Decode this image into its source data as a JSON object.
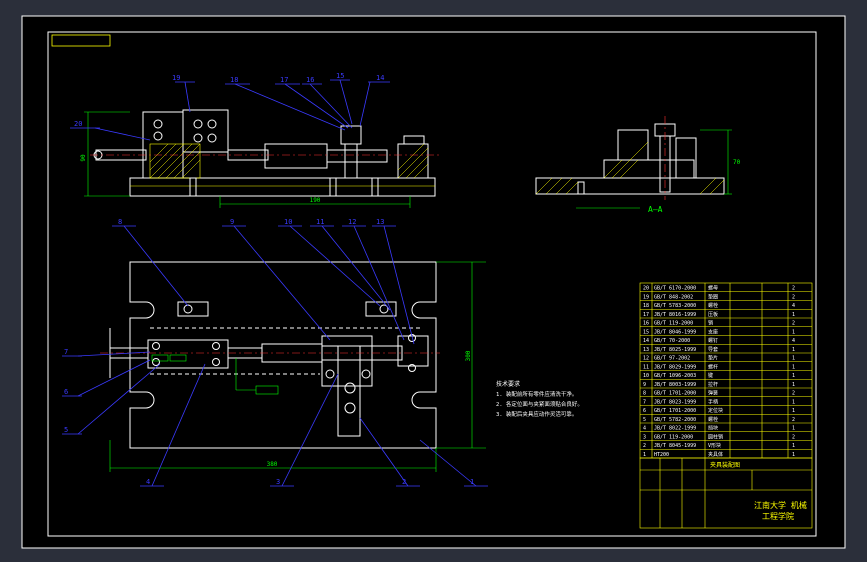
{
  "colors": {
    "frame_bg": "#2b2f3a",
    "sheet_bg": "#000000",
    "border": "#ffffff",
    "leader": "#3a3aff",
    "dimension": "#00ff00",
    "part_outline": "#ffffff",
    "hatch": "#ffff00",
    "center_line": "#ff3030",
    "title_block": "#ffff00"
  },
  "section_label": "A—A",
  "top_callouts": [
    "19",
    "18",
    "17",
    "16",
    "15",
    "14",
    "20"
  ],
  "plan_callouts_top": [
    "8",
    "9",
    "10",
    "11",
    "12",
    "13"
  ],
  "plan_callouts_left": [
    "7",
    "6",
    "5"
  ],
  "plan_callouts_bottom": [
    "4",
    "3",
    "2",
    "1"
  ],
  "dimensions": {
    "overall_length": "380",
    "plan_height": "300",
    "elev_length": "190",
    "elev_height": "90",
    "section_height": "70"
  },
  "technical_requirements": {
    "title": "技术要求",
    "lines": [
      "1. 装配前所有零件应清洗干净。",
      "2. 各定位面与夹紧面须贴合良好。",
      "3. 装配后夹具应动作灵活可靠。"
    ]
  },
  "bom_rows": [
    {
      "no": "20",
      "code": "GB/T 6170-2000",
      "name": "螺母",
      "qty": "2"
    },
    {
      "no": "19",
      "code": "GB/T 848-2002",
      "name": "垫圈",
      "qty": "2"
    },
    {
      "no": "18",
      "code": "GB/T 5783-2000",
      "name": "螺栓",
      "qty": "4"
    },
    {
      "no": "17",
      "code": "JB/T 8016-1999",
      "name": "压板",
      "qty": "1"
    },
    {
      "no": "16",
      "code": "GB/T 119-2000",
      "name": "销",
      "qty": "2"
    },
    {
      "no": "15",
      "code": "JB/T 8046-1999",
      "name": "支座",
      "qty": "1"
    },
    {
      "no": "14",
      "code": "GB/T 70-2000",
      "name": "螺钉",
      "qty": "4"
    },
    {
      "no": "13",
      "code": "JB/T 8025-1999",
      "name": "导套",
      "qty": "1"
    },
    {
      "no": "12",
      "code": "GB/T 97-2002",
      "name": "垫片",
      "qty": "1"
    },
    {
      "no": "11",
      "code": "JB/T 8029-1999",
      "name": "螺杆",
      "qty": "1"
    },
    {
      "no": "10",
      "code": "GB/T 1096-2003",
      "name": "键",
      "qty": "1"
    },
    {
      "no": "9",
      "code": "JB/T 8003-1999",
      "name": "拉杆",
      "qty": "1"
    },
    {
      "no": "8",
      "code": "GB/T 1701-2000",
      "name": "弹簧",
      "qty": "2"
    },
    {
      "no": "7",
      "code": "JB/T 8023-1999",
      "name": "手柄",
      "qty": "1"
    },
    {
      "no": "6",
      "code": "GB/T 1701-2000",
      "name": "定位块",
      "qty": "1"
    },
    {
      "no": "5",
      "code": "GB/T 5782-2000",
      "name": "螺栓",
      "qty": "2"
    },
    {
      "no": "4",
      "code": "JB/T 8022-1999",
      "name": "挡块",
      "qty": "1"
    },
    {
      "no": "3",
      "code": "GB/T 119-2000",
      "name": "圆柱销",
      "qty": "2"
    },
    {
      "no": "2",
      "code": "JB/T 8045-1999",
      "name": "V形块",
      "qty": "1"
    },
    {
      "no": "1",
      "code": "HT200",
      "name": "夹具体",
      "qty": "1"
    }
  ],
  "title_block": {
    "drawing_name": "夹具装配图",
    "school": "江南大学 机械",
    "department": "工程学院"
  }
}
